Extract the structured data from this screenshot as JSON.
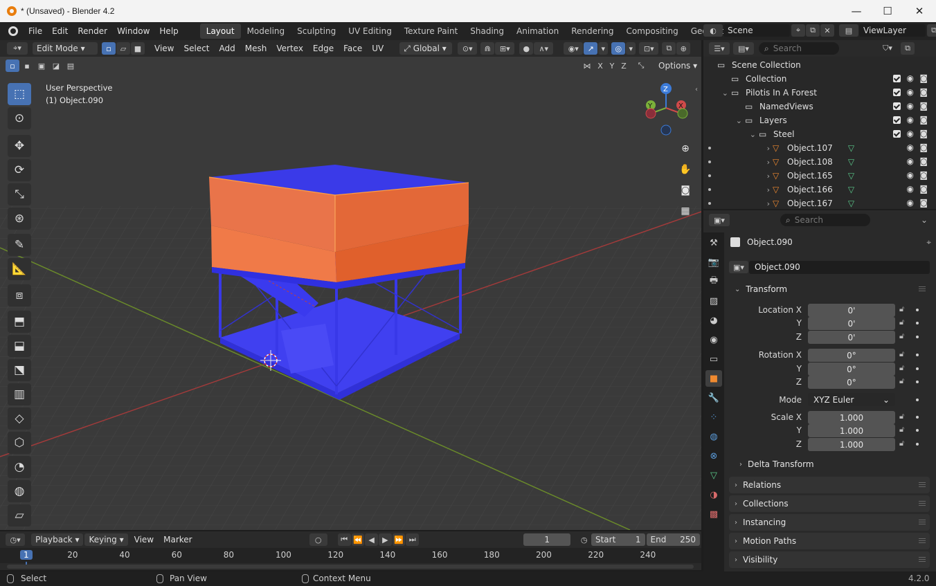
{
  "window": {
    "title": "* (Unsaved) - Blender 4.2",
    "min": "—",
    "max": "☐",
    "close": "✕"
  },
  "menu": [
    "File",
    "Edit",
    "Render",
    "Window",
    "Help"
  ],
  "workspaces": [
    "Layout",
    "Modeling",
    "Sculpting",
    "UV Editing",
    "Texture Paint",
    "Shading",
    "Animation",
    "Rendering",
    "Compositing",
    "Geometry No"
  ],
  "scene": {
    "name": "Scene",
    "view_layer": "ViewLayer"
  },
  "vp_header": {
    "mode": "Edit Mode",
    "menus": [
      "View",
      "Select",
      "Add",
      "Mesh",
      "Vertex",
      "Edge",
      "Face",
      "UV"
    ],
    "transform": "Global"
  },
  "vp_header2": {
    "axes": [
      "X",
      "Y",
      "Z"
    ],
    "options": "Options"
  },
  "overlay": {
    "perspective": "User Perspective",
    "object": "(1) Object.090"
  },
  "gizmo": {
    "z": "Z",
    "y": "Y",
    "x": "X"
  },
  "outliner": {
    "search_placeholder": "Search",
    "rows": [
      {
        "label": "Scene Collection",
        "indent": 0,
        "arrow": "",
        "icon": "scene-collection-icon",
        "check": false
      },
      {
        "label": "Collection",
        "indent": 1,
        "arrow": "",
        "icon": "collection-icon",
        "check": true
      },
      {
        "label": "Pilotis In A Forest",
        "indent": 1,
        "arrow": "⌄",
        "icon": "collection-icon",
        "check": true
      },
      {
        "label": "NamedViews",
        "indent": 2,
        "arrow": "",
        "icon": "collection-icon",
        "check": true
      },
      {
        "label": "Layers",
        "indent": 2,
        "arrow": "⌄",
        "icon": "collection-icon",
        "check": true
      },
      {
        "label": "Steel",
        "indent": 3,
        "arrow": "⌄",
        "icon": "collection-icon",
        "check": true
      },
      {
        "label": "Object.107",
        "indent": 4,
        "arrow": "›",
        "icon": "mesh-icon",
        "check": false
      },
      {
        "label": "Object.108",
        "indent": 4,
        "arrow": "›",
        "icon": "mesh-icon",
        "check": false
      },
      {
        "label": "Object.165",
        "indent": 4,
        "arrow": "›",
        "icon": "mesh-icon",
        "check": false
      },
      {
        "label": "Object.166",
        "indent": 4,
        "arrow": "›",
        "icon": "mesh-icon",
        "check": false
      },
      {
        "label": "Object.167",
        "indent": 4,
        "arrow": "›",
        "icon": "mesh-icon",
        "check": false
      }
    ]
  },
  "props": {
    "search_placeholder": "Search",
    "object_name": "Object.090",
    "datablock": "Object.090",
    "transform": "Transform",
    "location": {
      "label": "Location X",
      "x": "0'",
      "y": "0'",
      "z": "0'"
    },
    "rotation": {
      "label": "Rotation X",
      "x": "0°",
      "y": "0°",
      "z": "0°"
    },
    "mode": {
      "label": "Mode",
      "value": "XYZ Euler"
    },
    "scale": {
      "label": "Scale X",
      "x": "1.000",
      "y": "1.000",
      "z": "1.000"
    },
    "axis_y": "Y",
    "axis_z": "Z",
    "delta": "Delta Transform",
    "panels": [
      "Relations",
      "Collections",
      "Instancing",
      "Motion Paths",
      "Visibility"
    ]
  },
  "timeline": {
    "playback": "Playback",
    "keying": "Keying",
    "view": "View",
    "marker": "Marker",
    "frame": "1",
    "start_label": "Start",
    "start": "1",
    "end_label": "End",
    "end": "250",
    "ticks": [
      "1",
      "20",
      "40",
      "60",
      "80",
      "100",
      "120",
      "140",
      "160",
      "180",
      "200",
      "220",
      "240"
    ]
  },
  "status": {
    "select": "Select",
    "pan": "Pan View",
    "context": "Context Menu",
    "version": "4.2.0"
  },
  "colors": {
    "accent": "#4772b3",
    "selected_face": "#e8692e",
    "mesh": "#3c3cf0"
  }
}
